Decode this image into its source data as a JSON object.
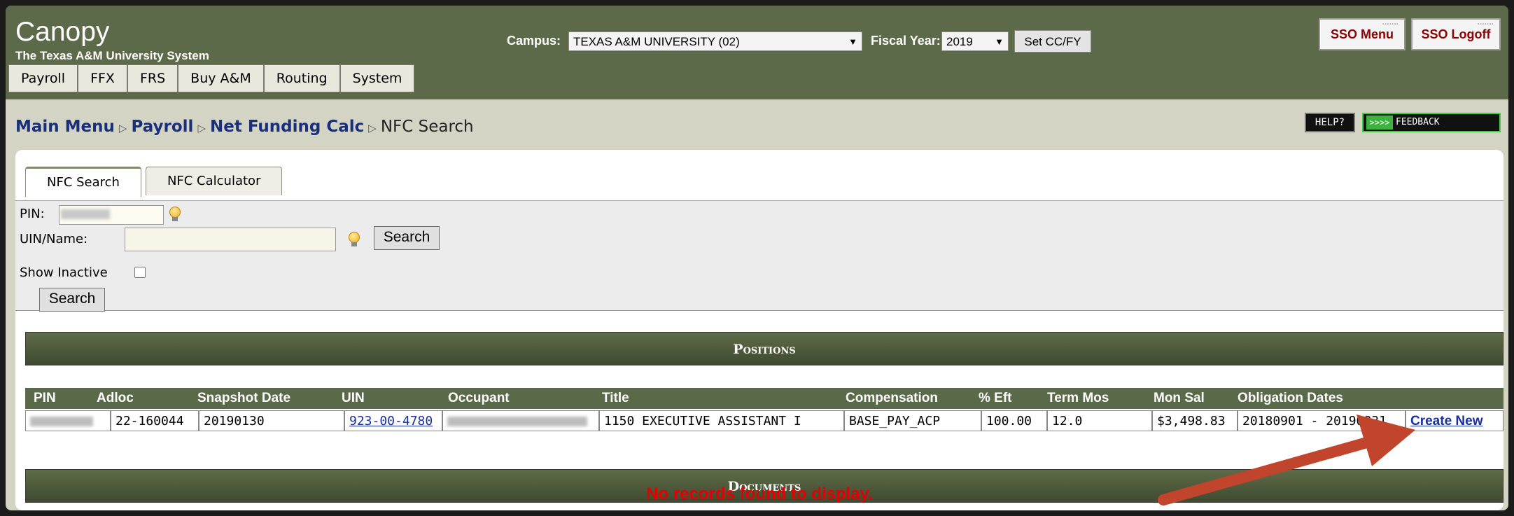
{
  "header": {
    "app_name": "Canopy",
    "org": "The Texas A&M University System",
    "nav": [
      "Payroll",
      "FFX",
      "FRS",
      "Buy A&M",
      "Routing",
      "System"
    ],
    "campus_label": "Campus:",
    "campus_value": "TEXAS A&M UNIVERSITY (02)",
    "fy_label": "Fiscal Year:",
    "fy_value": "2019",
    "set_button": "Set CC/FY",
    "sso_menu": "SSO Menu",
    "sso_logoff": "SSO Logoff"
  },
  "breadcrumb": {
    "items": [
      "Main Menu",
      "Payroll",
      "Net Funding Calc"
    ],
    "current": "NFC Search"
  },
  "utility": {
    "help": "HELP?",
    "feedback_arrows": ">>>>",
    "feedback": "FEEDBACK"
  },
  "tabs": [
    "NFC Search",
    "NFC Calculator"
  ],
  "search": {
    "pin_label": "PIN:",
    "uin_label": "UIN/Name:",
    "uin_search_button": "Search",
    "show_inactive_label": "Show Inactive",
    "search_button": "Search"
  },
  "positions": {
    "title": "Positions",
    "columns": [
      "PIN",
      "Adloc",
      "Snapshot Date",
      "UIN",
      "Occupant",
      "Title",
      "Compensation",
      "% Eft",
      "Term Mos",
      "Mon Sal",
      "Obligation Dates"
    ],
    "row": {
      "adloc": "22-160044",
      "snapshot_date": "20190130",
      "uin": "923-00-4780",
      "title": "1150 EXECUTIVE ASSISTANT I",
      "compensation": "BASE_PAY_ACP",
      "eft": "100.00",
      "term_mos": "12.0",
      "mon_sal": "$3,498.83",
      "obligation_dates": "20180901 - 20190831",
      "action": "Create New"
    }
  },
  "documents": {
    "title": "Documents",
    "empty_message": "No records found to display."
  },
  "colors": {
    "header_green": "#5c6a4a",
    "link_blue": "#1a2f7c",
    "alert_red": "#e00000",
    "arrow": "#c0452c"
  }
}
